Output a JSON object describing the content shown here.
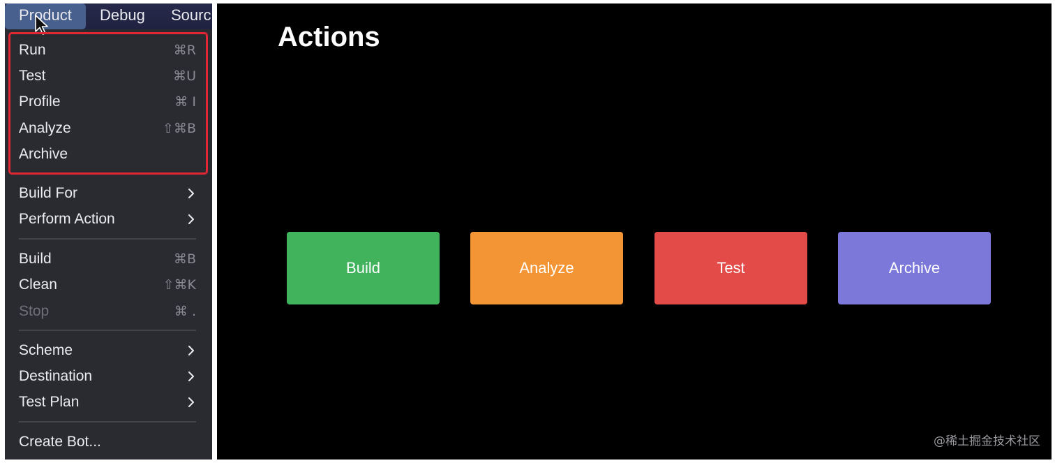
{
  "menubar": {
    "items": [
      {
        "label": "Product",
        "active": true
      },
      {
        "label": "Debug",
        "active": false
      },
      {
        "label": "Sourc",
        "active": false
      }
    ]
  },
  "menu": {
    "items": [
      {
        "label": "Run",
        "shortcut": "⌘R",
        "disabled": false
      },
      {
        "label": "Test",
        "shortcut": "⌘U",
        "disabled": false
      },
      {
        "label": "Profile",
        "shortcut": "⌘ I",
        "disabled": false
      },
      {
        "label": "Analyze",
        "shortcut": "⇧⌘B",
        "disabled": false
      },
      {
        "label": "Archive",
        "shortcut": "",
        "disabled": false
      },
      {
        "label": "Build For",
        "submenu": true
      },
      {
        "label": "Perform Action",
        "submenu": true
      },
      {
        "label": "Build",
        "shortcut": "⌘B",
        "disabled": false
      },
      {
        "label": "Clean",
        "shortcut": "⇧⌘K",
        "disabled": false
      },
      {
        "label": "Stop",
        "shortcut": "⌘ .",
        "disabled": true
      },
      {
        "label": "Scheme",
        "submenu": true
      },
      {
        "label": "Destination",
        "submenu": true
      },
      {
        "label": "Test Plan",
        "submenu": true
      },
      {
        "label": "Create Bot...",
        "shortcut": "",
        "disabled": false
      }
    ]
  },
  "app": {
    "title": "Actions",
    "buttons": [
      {
        "label": "Build",
        "color": "#41b35d"
      },
      {
        "label": "Analyze",
        "color": "#f39535"
      },
      {
        "label": "Test",
        "color": "#e24b48"
      },
      {
        "label": "Archive",
        "color": "#7c78d9"
      }
    ]
  },
  "watermark": "@稀土掘金技术社区",
  "colors": {
    "highlight": "#e32633",
    "menu_background": "#2a2b31",
    "app_background": "#000000"
  }
}
